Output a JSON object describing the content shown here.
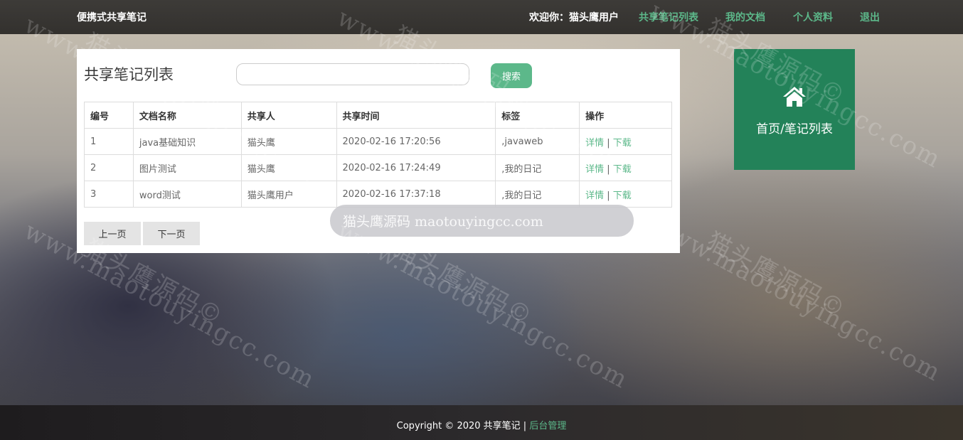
{
  "header": {
    "brand": "便携式共享笔记",
    "welcome": "欢迎你：猫头鹰用户",
    "nav": [
      {
        "label": "共享笔记列表"
      },
      {
        "label": "我的文档"
      },
      {
        "label": "个人资料"
      },
      {
        "label": "退出"
      }
    ]
  },
  "main": {
    "title": "共享笔记列表",
    "search": {
      "value": "",
      "placeholder": "",
      "button_label": "搜索"
    },
    "table": {
      "columns": [
        "编号",
        "文档名称",
        "共享人",
        "共享时间",
        "标签",
        "操作"
      ],
      "rows": [
        {
          "id": "1",
          "name": "java基础知识",
          "sharer": "猫头鹰",
          "time": "2020-02-16 17:20:56",
          "tag": ",javaweb",
          "detail": "详情",
          "download": "下载"
        },
        {
          "id": "2",
          "name": "图片测试",
          "sharer": "猫头鹰",
          "time": "2020-02-16 17:24:49",
          "tag": ",我的日记",
          "detail": "详情",
          "download": "下载"
        },
        {
          "id": "3",
          "name": "word测试",
          "sharer": "猫头鹰用户",
          "time": "2020-02-16 17:37:18",
          "tag": ",我的日记",
          "detail": "详情",
          "download": "下载"
        }
      ],
      "separator": "|"
    },
    "pager": {
      "prev": "上一页",
      "next": "下一页"
    }
  },
  "overlay": {
    "text": "猫头鹰源码 maotouyingcc.com"
  },
  "home_tile": {
    "label": "首页/笔记列表",
    "icon": "home-icon"
  },
  "footer": {
    "copyright": "Copyright © 2020 共享笔记 |",
    "admin_link": "后台管理"
  },
  "watermark": {
    "text": "www.maotouyingcc.com",
    "cn_text": "猫头鹰源码©"
  },
  "colors": {
    "accent": "#5cb88a",
    "tile": "#238259",
    "topbar": "#3d3b38"
  }
}
